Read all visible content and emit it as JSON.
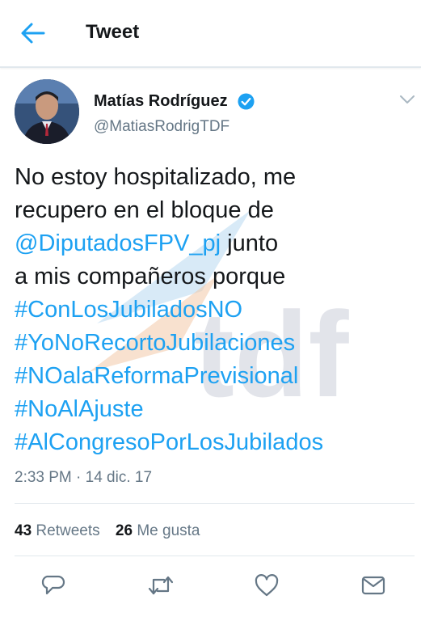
{
  "header": {
    "title": "Tweet",
    "back_icon": "arrow-left-icon"
  },
  "author": {
    "name": "Matías Rodríguez",
    "handle": "@MatiasRodrigTDF",
    "verified_icon": "verified-badge-icon",
    "verified_color": "#1da1f2"
  },
  "tweet": {
    "lines": [
      {
        "text": "No estoy hospitalizado, me"
      },
      {
        "text": "recupero en el bloque de"
      },
      {
        "mention": "@DiputadosFPV_pj",
        "rest": " junto"
      },
      {
        "text": "a mis compañeros porque"
      },
      {
        "hashtag": "#ConLosJubiladosNO"
      },
      {
        "hashtag": "#YoNoRecortoJubilaciones"
      },
      {
        "hashtag": "#NOalaReformaPrevisional"
      },
      {
        "hashtag": "#NoAlAjuste"
      },
      {
        "hashtag": "#AlCongresoPorLosJubilados"
      }
    ],
    "timestamp": "2:33 PM · 14 dic. 17"
  },
  "watermark_text": "tdf",
  "stats": {
    "retweets_count": "43",
    "retweets_label": "Retweets",
    "likes_count": "26",
    "likes_label": "Me gusta"
  },
  "actions": [
    "reply-icon",
    "retweet-icon",
    "like-icon",
    "message-icon"
  ],
  "colors": {
    "link": "#1da1f2",
    "text": "#14171a",
    "muted": "#657786",
    "divider": "#e1e8ed"
  }
}
